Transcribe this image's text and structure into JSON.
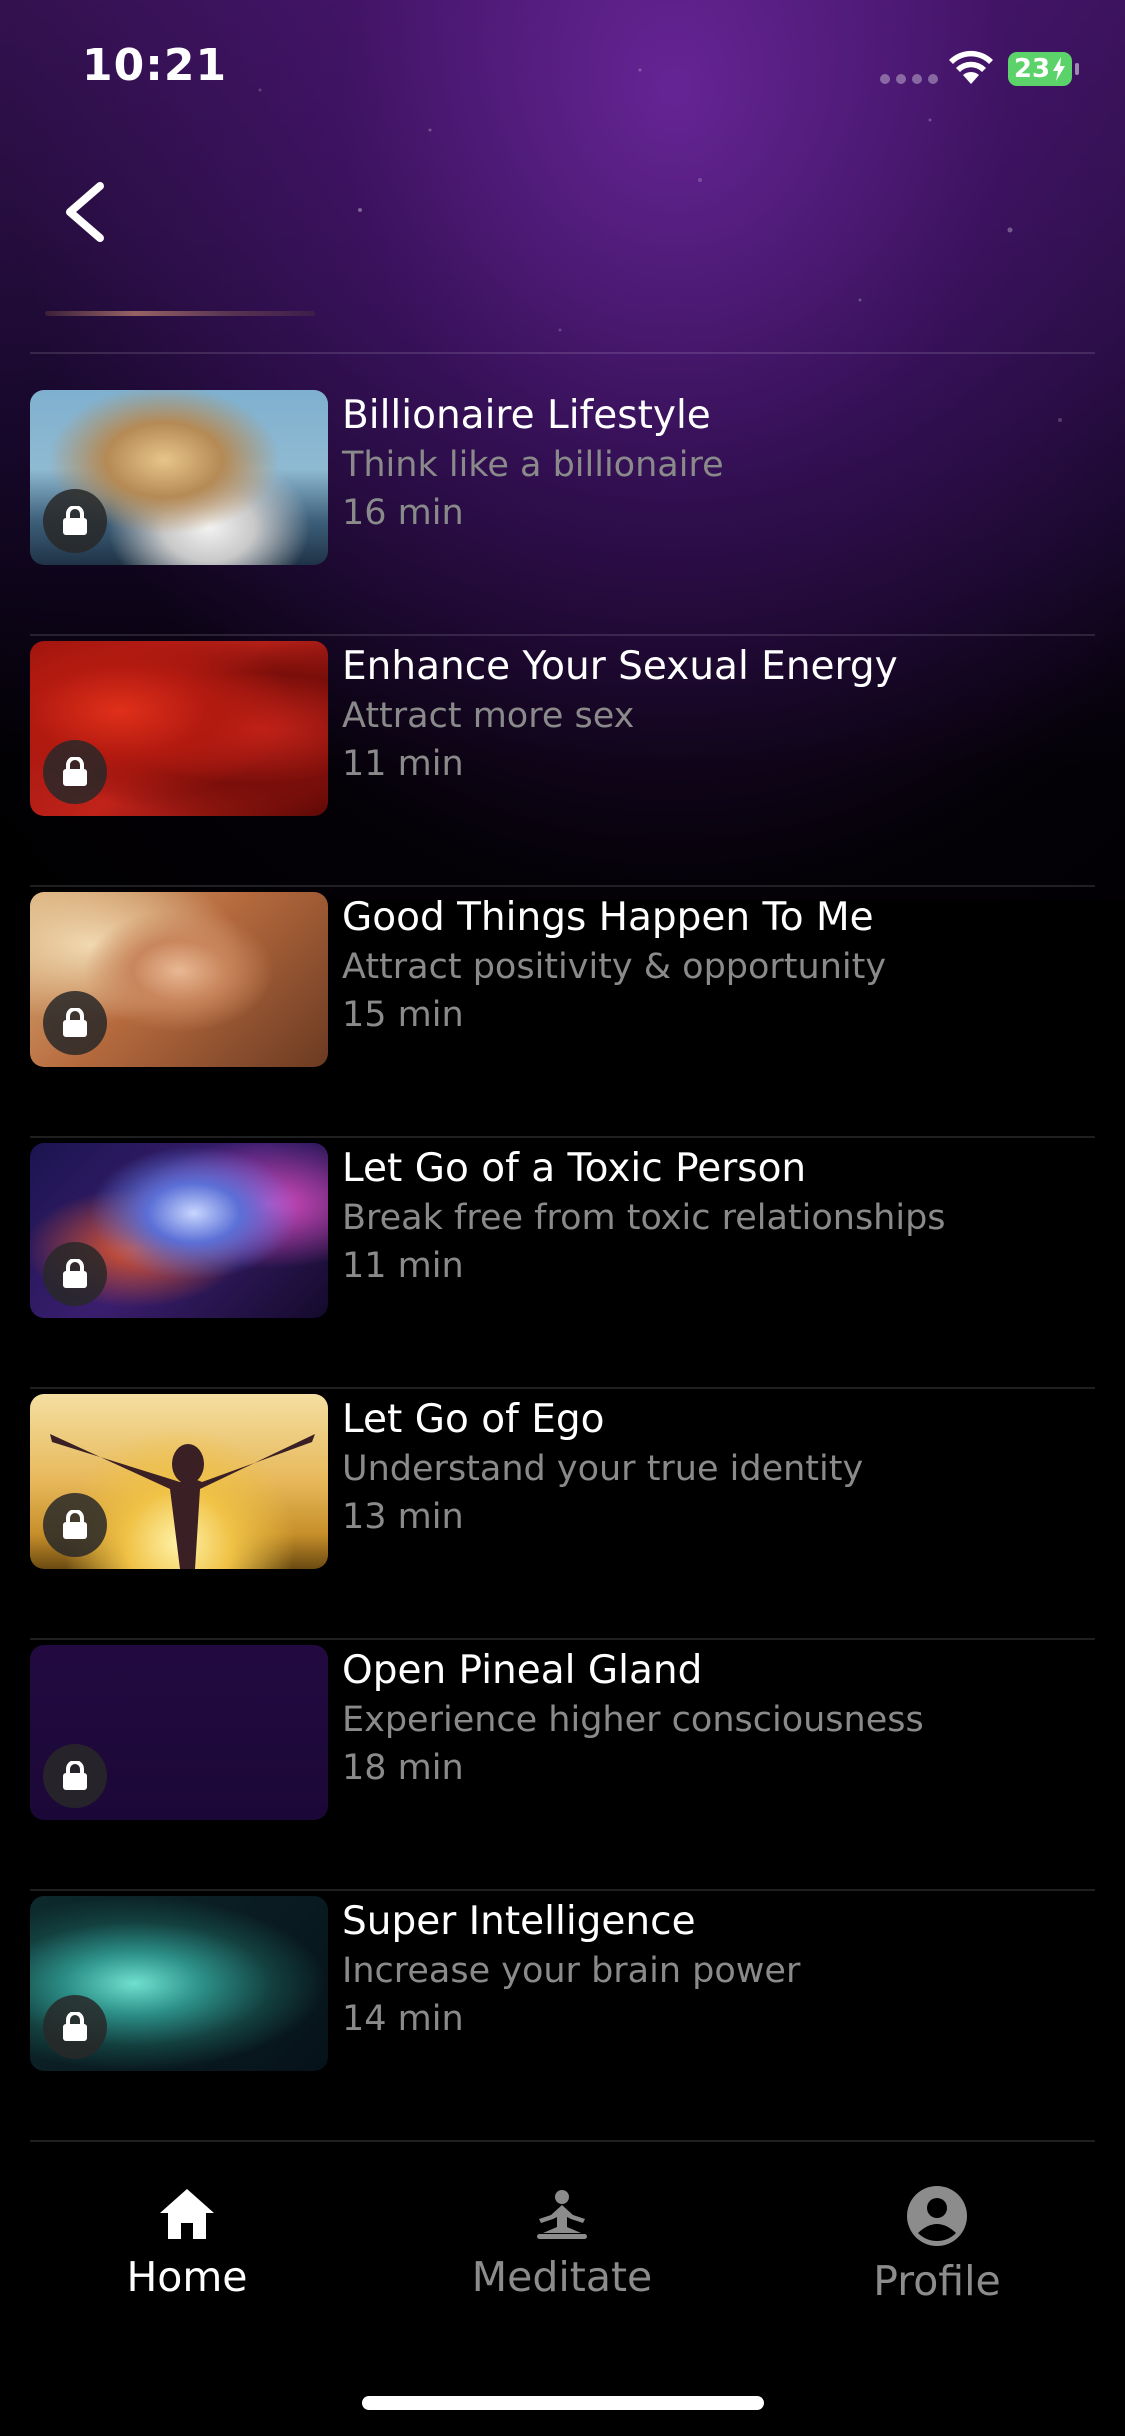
{
  "status_bar": {
    "time": "10:21",
    "battery": "23"
  },
  "navigation": {
    "back_icon": "chevron-left-icon"
  },
  "meditations": [
    {
      "title": "Billionaire Lifestyle",
      "subtitle": "Think like a billionaire",
      "duration": "16 min",
      "locked": true
    },
    {
      "title": "Enhance Your Sexual Energy",
      "subtitle": "Attract more sex",
      "duration": "11 min",
      "locked": true
    },
    {
      "title": "Good Things Happen To Me",
      "subtitle": "Attract positivity & opportunity",
      "duration": "15 min",
      "locked": true
    },
    {
      "title": "Let Go of a Toxic Person",
      "subtitle": "Break free from toxic relationships",
      "duration": "11 min",
      "locked": true
    },
    {
      "title": "Let Go of Ego",
      "subtitle": "Understand your true identity",
      "duration": "13 min",
      "locked": true
    },
    {
      "title": "Open Pineal Gland",
      "subtitle": "Experience higher consciousness",
      "duration": "18 min",
      "locked": true
    },
    {
      "title": "Super Intelligence",
      "subtitle": "Increase your brain power",
      "duration": "14 min",
      "locked": true
    }
  ],
  "tab_bar": {
    "tabs": [
      {
        "label": "Home",
        "icon": "home-icon",
        "active": true
      },
      {
        "label": "Meditate",
        "icon": "meditate-icon",
        "active": false
      },
      {
        "label": "Profile",
        "icon": "profile-icon",
        "active": false
      }
    ]
  },
  "colors": {
    "background": "#000000",
    "accent_purple": "#3b145a",
    "muted_text": "#8a8a8a",
    "battery": "#5bd36a"
  }
}
